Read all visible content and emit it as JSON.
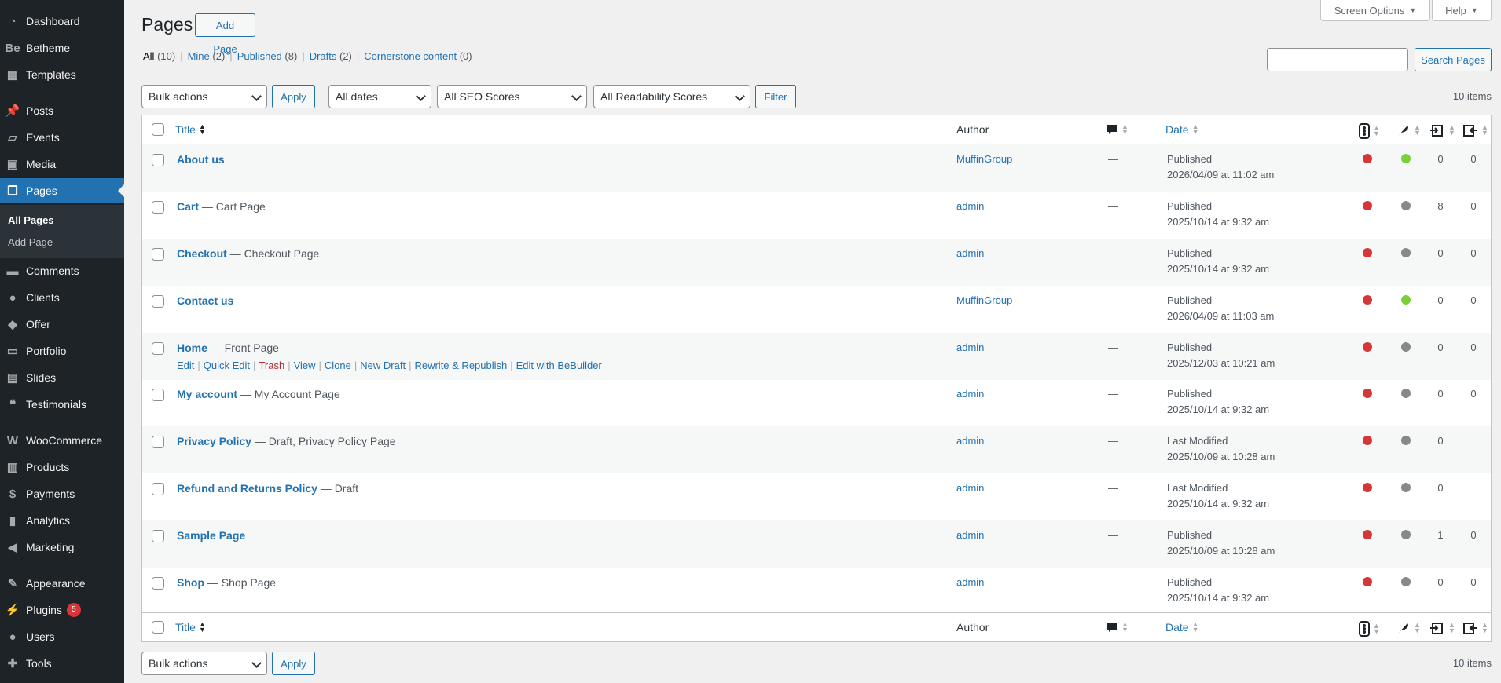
{
  "sidebar": {
    "items": [
      {
        "label": "Dashboard",
        "icon": "dashboard-icon"
      },
      {
        "label": "Betheme",
        "icon": "betheme-icon"
      },
      {
        "label": "Templates",
        "icon": "templates-icon"
      },
      {
        "label": "Posts",
        "icon": "pin-icon"
      },
      {
        "label": "Events",
        "icon": "events-icon"
      },
      {
        "label": "Media",
        "icon": "media-icon"
      },
      {
        "label": "Pages",
        "icon": "pages-icon"
      },
      {
        "label": "Comments",
        "icon": "comments-icon"
      },
      {
        "label": "Clients",
        "icon": "clients-icon"
      },
      {
        "label": "Offer",
        "icon": "offer-icon"
      },
      {
        "label": "Portfolio",
        "icon": "portfolio-icon"
      },
      {
        "label": "Slides",
        "icon": "slides-icon"
      },
      {
        "label": "Testimonials",
        "icon": "quote-icon"
      },
      {
        "label": "WooCommerce",
        "icon": "woocommerce-icon"
      },
      {
        "label": "Products",
        "icon": "products-icon"
      },
      {
        "label": "Payments",
        "icon": "payments-icon"
      },
      {
        "label": "Analytics",
        "icon": "analytics-icon"
      },
      {
        "label": "Marketing",
        "icon": "marketing-icon"
      },
      {
        "label": "Appearance",
        "icon": "appearance-icon"
      },
      {
        "label": "Plugins",
        "icon": "plugins-icon",
        "badge": "5"
      },
      {
        "label": "Users",
        "icon": "users-icon"
      },
      {
        "label": "Tools",
        "icon": "tools-icon"
      }
    ],
    "submenu": [
      "All Pages",
      "Add Page"
    ]
  },
  "header": {
    "title": "Pages",
    "add_button": "Add Page",
    "screen_options": "Screen Options",
    "help": "Help"
  },
  "views": [
    {
      "label": "All",
      "count": "(10)"
    },
    {
      "label": "Mine",
      "count": "(2)"
    },
    {
      "label": "Published",
      "count": "(8)"
    },
    {
      "label": "Drafts",
      "count": "(2)"
    },
    {
      "label": "Cornerstone content",
      "count": "(0)"
    }
  ],
  "search": {
    "button": "Search Pages",
    "value": ""
  },
  "filters": {
    "bulk_actions": "Bulk actions",
    "apply": "Apply",
    "dates": "All dates",
    "seo": "All SEO Scores",
    "readability": "All Readability Scores",
    "filter": "Filter",
    "items_count": "10 items"
  },
  "table": {
    "headers": {
      "title": "Title",
      "author": "Author",
      "date": "Date"
    },
    "row_actions": [
      "Edit",
      "Quick Edit",
      "Trash",
      "View",
      "Clone",
      "New Draft",
      "Rewrite & Republish",
      "Edit with BeBuilder"
    ],
    "rows": [
      {
        "title": "About us",
        "suffix": "",
        "author": "MuffinGroup",
        "comments": "—",
        "status": "Published",
        "date": "2026/04/09 at 11:02 am",
        "seo": "#d63638",
        "read": "#7ad03a",
        "links": "0",
        "linked": "0"
      },
      {
        "title": "Cart",
        "suffix": " — Cart Page",
        "author": "admin",
        "comments": "—",
        "status": "Published",
        "date": "2025/10/14 at 9:32 am",
        "seo": "#d63638",
        "read": "#888888",
        "links": "8",
        "linked": "0"
      },
      {
        "title": "Checkout",
        "suffix": " — Checkout Page",
        "author": "admin",
        "comments": "—",
        "status": "Published",
        "date": "2025/10/14 at 9:32 am",
        "seo": "#d63638",
        "read": "#888888",
        "links": "0",
        "linked": "0"
      },
      {
        "title": "Contact us",
        "suffix": "",
        "author": "MuffinGroup",
        "comments": "—",
        "status": "Published",
        "date": "2026/04/09 at 11:03 am",
        "seo": "#d63638",
        "read": "#7ad03a",
        "links": "0",
        "linked": "0"
      },
      {
        "title": "Home",
        "suffix": " — Front Page",
        "author": "admin",
        "comments": "—",
        "status": "Published",
        "date": "2025/12/03 at 10:21 am",
        "seo": "#d63638",
        "read": "#888888",
        "links": "0",
        "linked": "0"
      },
      {
        "title": "My account",
        "suffix": " — My Account Page",
        "author": "admin",
        "comments": "—",
        "status": "Published",
        "date": "2025/10/14 at 9:32 am",
        "seo": "#d63638",
        "read": "#888888",
        "links": "0",
        "linked": "0"
      },
      {
        "title": "Privacy Policy",
        "suffix": " — Draft, Privacy Policy Page",
        "author": "admin",
        "comments": "—",
        "status": "Last Modified",
        "date": "2025/10/09 at 10:28 am",
        "seo": "#d63638",
        "read": "#888888",
        "links": "0",
        "linked": ""
      },
      {
        "title": "Refund and Returns Policy",
        "suffix": " — Draft",
        "author": "admin",
        "comments": "—",
        "status": "Last Modified",
        "date": "2025/10/14 at 9:32 am",
        "seo": "#d63638",
        "read": "#888888",
        "links": "0",
        "linked": ""
      },
      {
        "title": "Sample Page",
        "suffix": "",
        "author": "admin",
        "comments": "—",
        "status": "Published",
        "date": "2025/10/09 at 10:28 am",
        "seo": "#d63638",
        "read": "#888888",
        "links": "1",
        "linked": "0"
      },
      {
        "title": "Shop",
        "suffix": " — Shop Page",
        "author": "admin",
        "comments": "—",
        "status": "Published",
        "date": "2025/10/14 at 9:32 am",
        "seo": "#d63638",
        "read": "#888888",
        "links": "0",
        "linked": "0"
      }
    ]
  },
  "colors": {
    "accent": "#2271b1",
    "sidebar": "#1d2327",
    "current": "#2271b1",
    "trash": "#b32d2e"
  }
}
